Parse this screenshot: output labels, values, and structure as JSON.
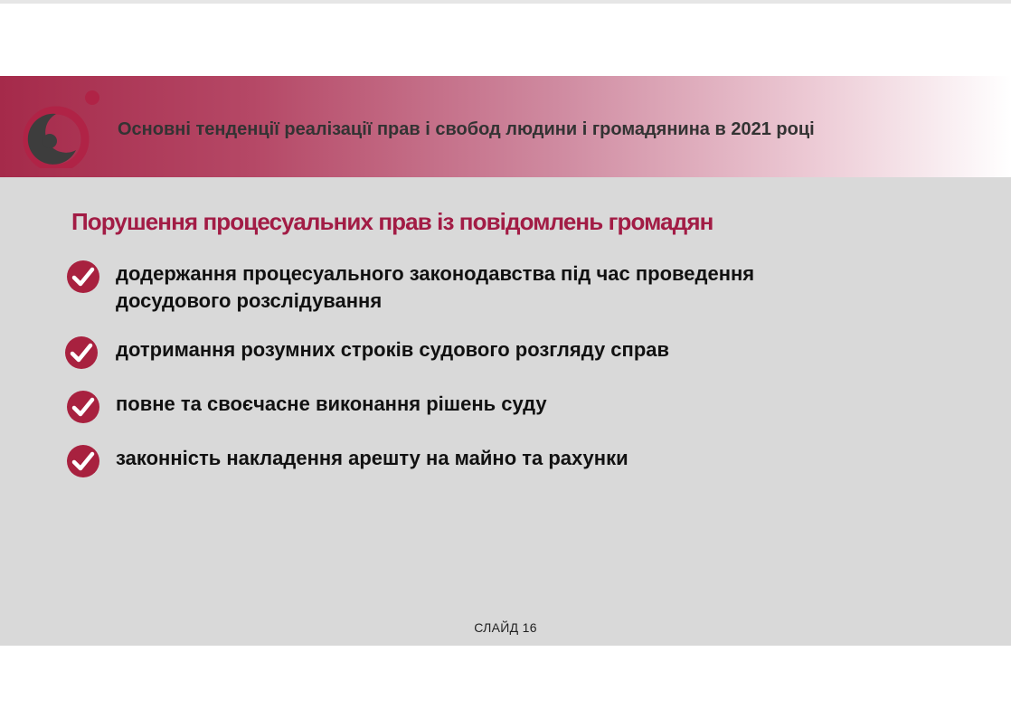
{
  "header": {
    "title": "Основні тенденції реалізації прав і свобод людини і громадянина в 2021 році"
  },
  "section": {
    "title": "Порушення процесуальних прав із повідомлень громадян"
  },
  "bullets": [
    {
      "line1": "додержання процесуального законодавства під час проведення",
      "line2": "досудового розслідування"
    },
    {
      "line1": "дотримання розумних строків судового розгляду справ",
      "line2": ""
    },
    {
      "line1": "повне та своєчасне виконання рішень суду",
      "line2": ""
    },
    {
      "line1": "законність накладення арешту на майно та рахунки",
      "line2": ""
    }
  ],
  "footer": {
    "slide_label": "СЛАЙД 16"
  },
  "colors": {
    "accent": "#a21c45",
    "check_fill": "#a8213f",
    "slide_background": "#d9d9d9",
    "logo_dark": "#3d3d3d"
  },
  "icons": {
    "logo": "ombudsman-logo-icon",
    "bullet": "checkmark-circle-icon"
  }
}
